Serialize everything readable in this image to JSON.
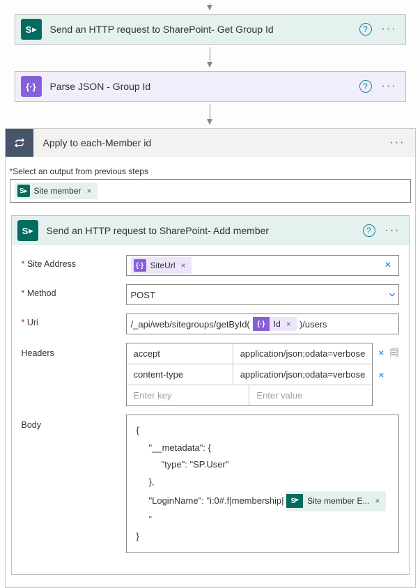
{
  "step1": {
    "title": "Send an HTTP request to SharePoint- Get Group Id"
  },
  "step2": {
    "title": "Parse JSON - Group Id"
  },
  "applyEach": {
    "title": "Apply to each-Member id",
    "selectLabel": "Select an output from previous steps",
    "token": "Site member"
  },
  "inner": {
    "title": "Send an HTTP request to SharePoint- Add member",
    "siteAddressLabel": "Site Address",
    "siteAddressToken": "SiteUrl",
    "methodLabel": "Method",
    "methodValue": "POST",
    "uriLabel": "Uri",
    "uriPrefix": "/_api/web/sitegroups/getById(",
    "uriToken": "Id",
    "uriSuffix": ")/users",
    "headersLabel": "Headers",
    "headers": [
      {
        "key": "accept",
        "value": "application/json;odata=verbose"
      },
      {
        "key": "content-type",
        "value": "application/json;odata=verbose"
      }
    ],
    "headerKeyPlaceholder": "Enter key",
    "headerValuePlaceholder": "Enter value",
    "bodyLabel": "Body",
    "body": {
      "line1": "{",
      "line2": "\"__metadata\": {",
      "line3": "\"type\": \"SP.User\"",
      "line4": "},",
      "line5a": "\"LoginName\": \"i:0#.f|membership|",
      "line5token": "Site member E...",
      "line5b": "\"",
      "line6": "}"
    }
  }
}
